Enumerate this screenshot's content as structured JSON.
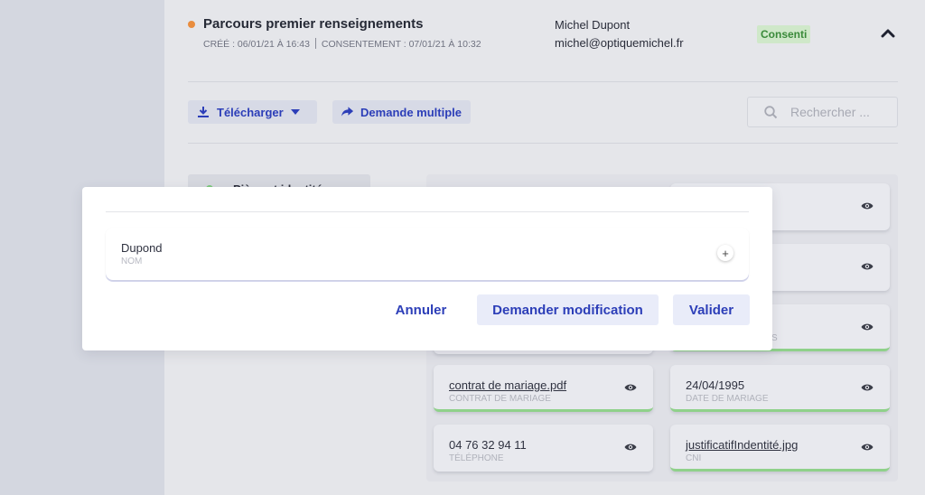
{
  "header": {
    "title": "Parcours premier renseignements",
    "created": "CRÉÉ : 06/01/21 À 16:43",
    "consent": "CONSENTEMENT : 07/01/21 À 10:32",
    "user_name": "Michel Dupont",
    "user_email": "michel@optiquemichel.fr",
    "status_badge": "Consenti"
  },
  "toolbar": {
    "download_label": "Télécharger",
    "multi_request_label": "Demande multiple",
    "search_placeholder": "Rechercher ..."
  },
  "side_tab": {
    "label": "Pièce et identité"
  },
  "cards": [
    {
      "value": "",
      "label": ""
    },
    {
      "value": "",
      "label": ""
    },
    {
      "value": "s",
      "label": ""
    },
    {
      "value": "",
      "label": ""
    },
    {
      "value": "",
      "label": "S"
    },
    {
      "value": "contrat de mariage.pdf",
      "label": "CONTRAT DE MARIAGE"
    },
    {
      "value": "24/04/1995",
      "label": "DATE DE MARIAGE"
    },
    {
      "value": "04 76 32 94 11",
      "label": "TÉLÉPHONE"
    },
    {
      "value": "justificatifIndentité.jpg",
      "label": "CNI"
    }
  ],
  "modal": {
    "field_value": "Dupond",
    "field_label": "NOM",
    "cancel_label": "Annuler",
    "request_change_label": "Demander modification",
    "validate_label": "Valider"
  },
  "colors": {
    "accent": "#2c3eb8",
    "status_dot": "#e98d3e",
    "consent_badge_bg": "#cfe8c9",
    "consent_badge_text": "#3a8a3a",
    "card_ok_border": "#8fd18a"
  }
}
